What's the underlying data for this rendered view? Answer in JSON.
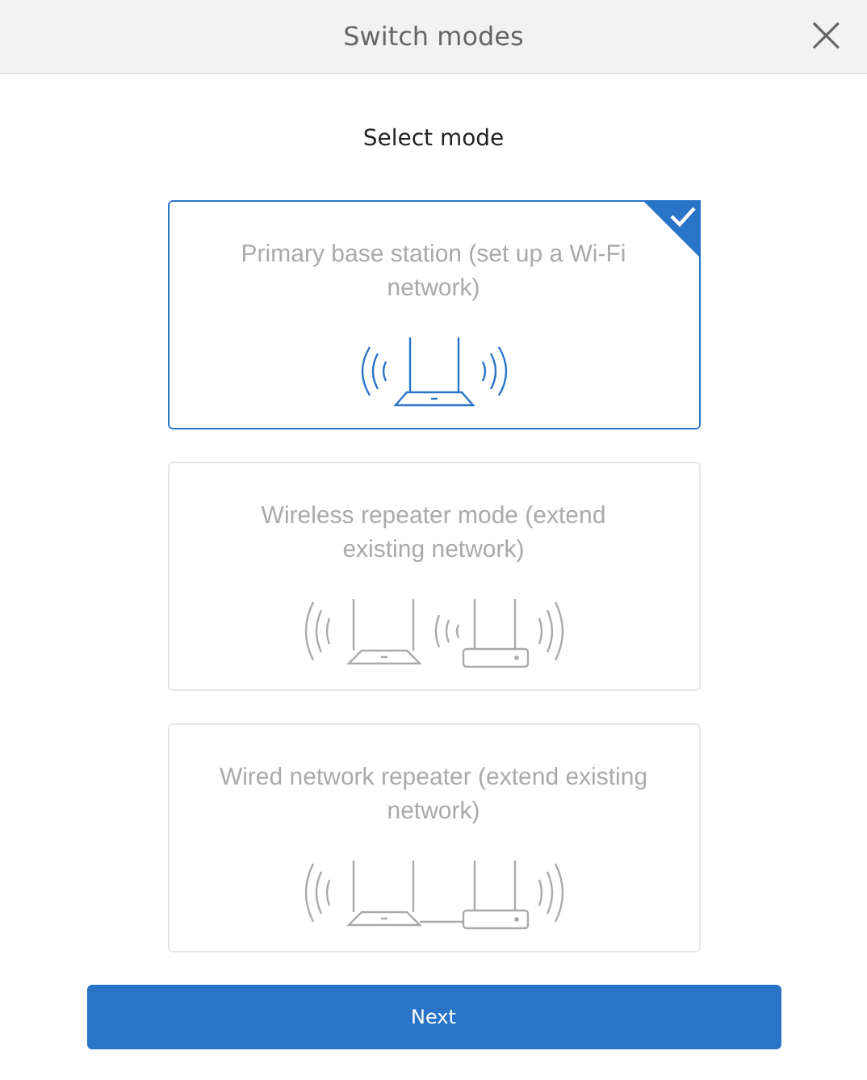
{
  "window": {
    "title": "Switch modes",
    "close": "×"
  },
  "heading": "Select mode",
  "modes": [
    {
      "kind": "primary",
      "label": "Primary base station (set up a Wi-Fi network)",
      "selected": true
    },
    {
      "kind": "wireless",
      "label": "Wireless repeater mode (extend existing network)",
      "selected": false
    },
    {
      "kind": "wired",
      "label": "Wired network repeater (extend existing network)",
      "selected": false
    }
  ],
  "next_button": "Next"
}
